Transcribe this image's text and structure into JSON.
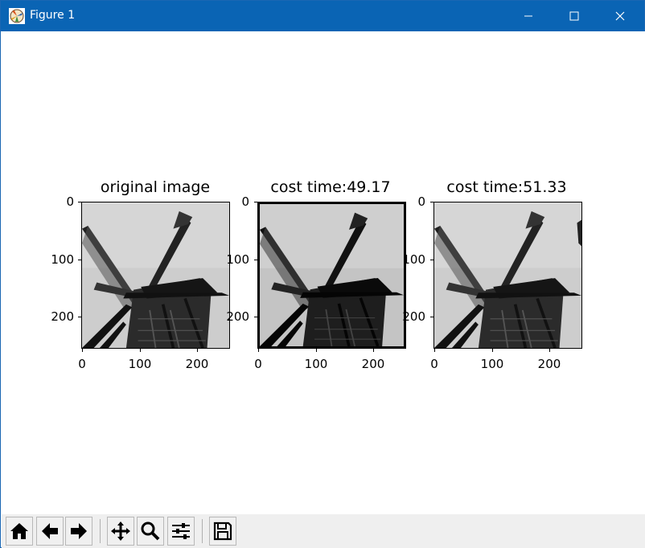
{
  "window": {
    "title": "Figure 1",
    "app_icon": "matplotlib-figure-icon",
    "controls": {
      "minimize": "minimize-icon",
      "maximize": "maximize-icon",
      "close": "close-icon"
    }
  },
  "figure": {
    "subplots": [
      {
        "title": "original image",
        "y_ticks": [
          "0",
          "100",
          "200"
        ],
        "x_ticks": [
          "0",
          "100",
          "200"
        ]
      },
      {
        "title": "cost time:49.17",
        "y_ticks": [
          "0",
          "100",
          "200"
        ],
        "x_ticks": [
          "0",
          "100",
          "200"
        ]
      },
      {
        "title": "cost time:51.33",
        "y_ticks": [
          "0",
          "100",
          "200"
        ],
        "x_ticks": [
          "0",
          "100",
          "200"
        ]
      }
    ]
  },
  "toolbar": {
    "buttons": [
      {
        "name": "home",
        "icon": "home-icon"
      },
      {
        "name": "back",
        "icon": "arrow-left-icon"
      },
      {
        "name": "forward",
        "icon": "arrow-right-icon"
      },
      {
        "name": "pan",
        "icon": "move-icon"
      },
      {
        "name": "zoom",
        "icon": "zoom-icon"
      },
      {
        "name": "configure-subplots",
        "icon": "sliders-icon"
      },
      {
        "name": "save",
        "icon": "save-icon"
      }
    ]
  }
}
